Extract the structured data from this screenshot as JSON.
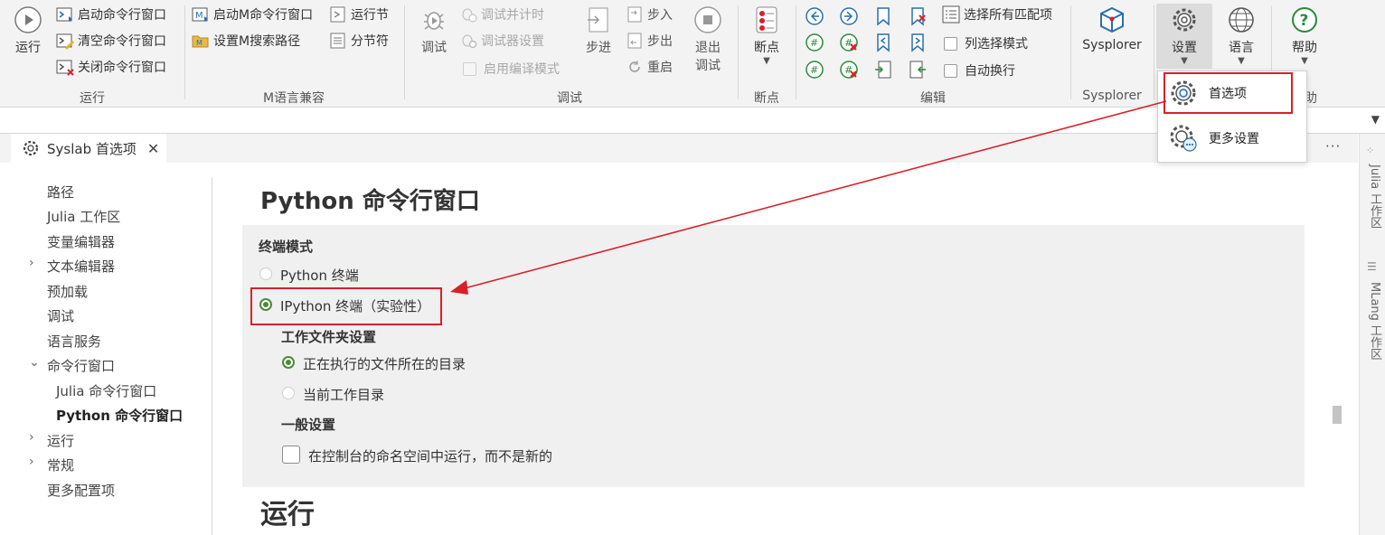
{
  "ribbon": {
    "run_group": {
      "run": "运行",
      "start_cmd": "启动命令行窗口",
      "clear_cmd": "清空命令行窗口",
      "close_cmd": "关闭命令行窗口",
      "label": "运行"
    },
    "m_group": {
      "start_m_cmd": "启动M命令行窗口",
      "set_m_path": "设置M搜索路径",
      "run_section": "运行节",
      "section_break": "分节符",
      "label": "M语言兼容"
    },
    "debug_group": {
      "debug": "调试",
      "debug_timer": "调试并计时",
      "debugger_settings": "调试器设置",
      "enable_compile": "启用编译模式",
      "step": "步进",
      "step_in": "步入",
      "step_out": "步出",
      "restart": "重启",
      "exit_debug_1": "退出",
      "exit_debug_2": "调试",
      "label": "调试"
    },
    "breakpoint_group": {
      "breakpoint": "断点",
      "label": "断点"
    },
    "edit_group": {
      "select_all_matches": "选择所有匹配项",
      "column_select": "列选择模式",
      "word_wrap": "自动换行",
      "label": "编辑"
    },
    "sysplorer_group": {
      "sysplorer": "Sysplorer",
      "label": "Sysplorer"
    },
    "settings": "设置",
    "language": "语言",
    "help": "帮助",
    "help_group_label": "助"
  },
  "dropdown": {
    "preferences": "首选项",
    "more_settings": "更多设置"
  },
  "tab": {
    "title": "Syslab 首选项"
  },
  "nav": [
    {
      "label": "路径",
      "expandable": false
    },
    {
      "label": "Julia 工作区",
      "expandable": false
    },
    {
      "label": "变量编辑器",
      "expandable": false
    },
    {
      "label": "文本编辑器",
      "expandable": true,
      "expanded": false
    },
    {
      "label": "预加载",
      "expandable": false
    },
    {
      "label": "调试",
      "expandable": false
    },
    {
      "label": "语言服务",
      "expandable": false
    },
    {
      "label": "命令行窗口",
      "expandable": true,
      "expanded": true
    },
    {
      "label": "Julia 命令行窗口",
      "child": true
    },
    {
      "label": "Python 命令行窗口",
      "child": true,
      "active": true
    },
    {
      "label": "运行",
      "expandable": true,
      "expanded": false
    },
    {
      "label": "常规",
      "expandable": true,
      "expanded": false
    },
    {
      "label": "更多配置项",
      "expandable": false
    }
  ],
  "content": {
    "title": "Python 命令行窗口",
    "terminal_mode": "终端模式",
    "python_terminal": "Python 终端",
    "ipython_terminal": "IPython 终端（实验性）",
    "workdir_settings": "工作文件夹设置",
    "current_file_dir": "正在执行的文件所在的目录",
    "current_work_dir": "当前工作目录",
    "general_settings": "一般设置",
    "run_in_console_ns": "在控制台的命名空间中运行，而不是新的",
    "run_section_title": "运行"
  },
  "right_panel": {
    "julia_workspace": "Julia 工作区",
    "mlang_workspace": "MLang 工作区"
  },
  "colors": {
    "accent_green": "#4c8a3a",
    "highlight_red": "#d9202a",
    "ribbon_bg": "#f3f3f3",
    "panel_bg": "#f0f0f0"
  }
}
